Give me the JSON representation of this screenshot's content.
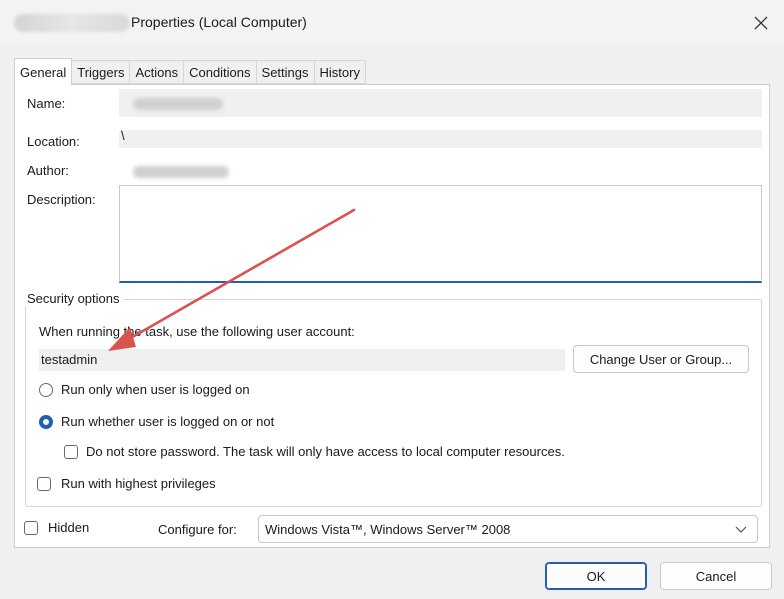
{
  "window": {
    "title": "Properties (Local Computer)",
    "close_label": "×"
  },
  "tabs": [
    {
      "label": "General"
    },
    {
      "label": "Triggers"
    },
    {
      "label": "Actions"
    },
    {
      "label": "Conditions"
    },
    {
      "label": "Settings"
    },
    {
      "label": "History"
    }
  ],
  "general": {
    "name_label": "Name:",
    "location_label": "Location:",
    "location_value": "\\",
    "author_label": "Author:",
    "description_label": "Description:",
    "description_value": ""
  },
  "security": {
    "group_title": "Security options",
    "account_prompt": "When running the task, use the following user account:",
    "user_account": "testadmin",
    "change_button": "Change User or Group...",
    "radio_logged_on": "Run only when user is logged on",
    "radio_whether": "Run whether user is logged on or not",
    "selected_radio": "Run whether user is logged on or not",
    "do_not_store": "Do not store password.  The task will only have access to local computer resources.",
    "do_not_store_checked": false,
    "highest_privileges": "Run with highest privileges",
    "highest_privileges_checked": false
  },
  "bottom": {
    "hidden_label": "Hidden",
    "hidden_checked": false,
    "configure_label": "Configure for:",
    "configure_value": "Windows Vista™, Windows Server™ 2008"
  },
  "buttons": {
    "ok": "OK",
    "cancel": "Cancel"
  },
  "colors": {
    "accent": "#1f5fb4",
    "annotation_arrow": "#d9534f"
  },
  "icons": {
    "close": "close-icon",
    "dropdown": "chevron-down-icon"
  }
}
